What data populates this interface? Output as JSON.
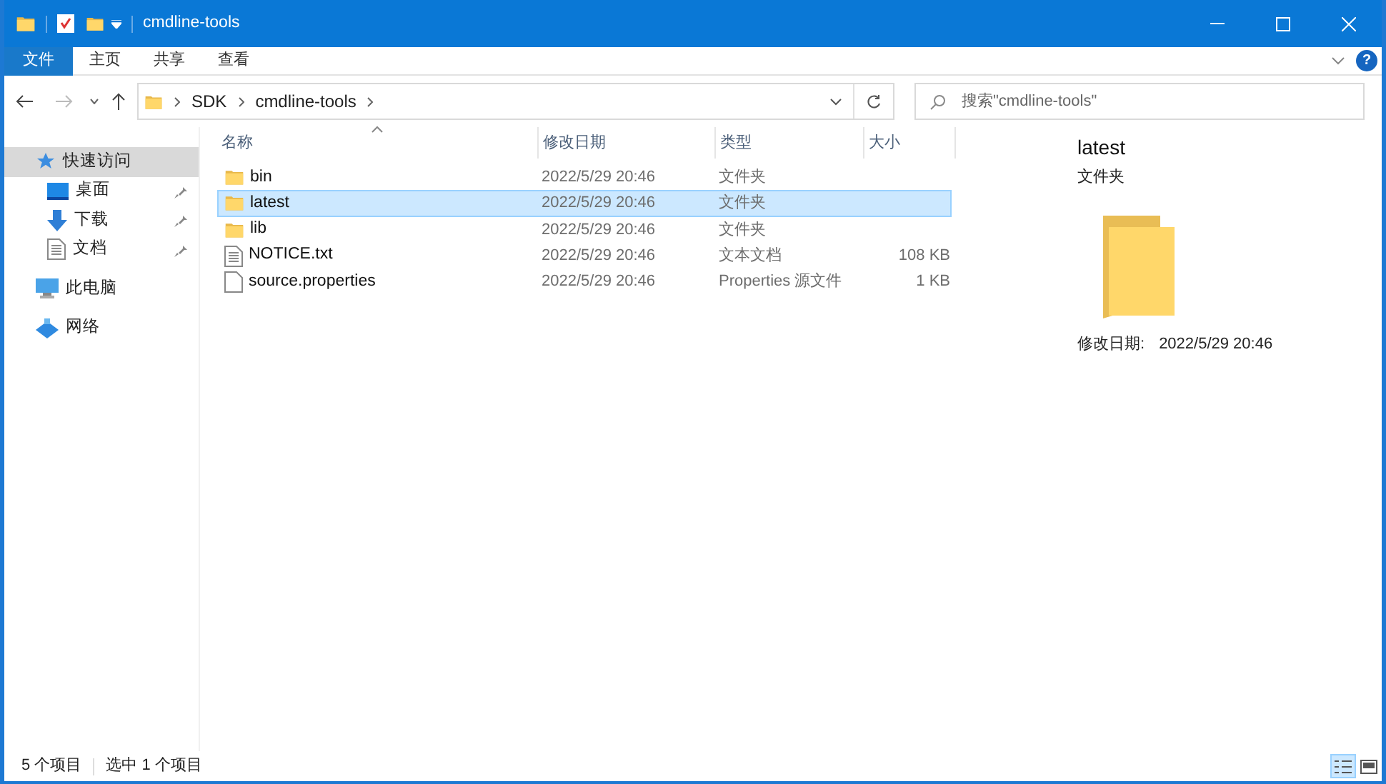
{
  "window": {
    "title": "cmdline-tools"
  },
  "ribbon": {
    "tabs": [
      {
        "label": "文件",
        "kind": "file"
      },
      {
        "label": "主页",
        "kind": "tab"
      },
      {
        "label": "共享",
        "kind": "tab"
      },
      {
        "label": "查看",
        "kind": "tab"
      }
    ]
  },
  "help": {
    "label": "?"
  },
  "address": {
    "path": [
      "SDK",
      "cmdline-tools"
    ]
  },
  "search": {
    "placeholder": "搜索\"cmdline-tools\""
  },
  "sidebar": {
    "items": [
      {
        "label": "快速访问",
        "kind": "star",
        "selected": true,
        "children": [
          {
            "label": "桌面",
            "kind": "desktop",
            "pinned": true,
            "selected": false
          },
          {
            "label": "下载",
            "kind": "download",
            "pinned": true,
            "selected": false
          },
          {
            "label": "文档",
            "kind": "document",
            "pinned": true,
            "selected": false
          }
        ]
      },
      {
        "label": "此电脑",
        "kind": "pc",
        "selected": false
      },
      {
        "label": "网络",
        "kind": "network",
        "selected": false
      }
    ]
  },
  "table": {
    "columns": [
      {
        "label": "名称",
        "sorted": true
      },
      {
        "label": "修改日期",
        "sorted": false
      },
      {
        "label": "类型",
        "sorted": false
      },
      {
        "label": "大小",
        "sorted": false
      }
    ],
    "rows": [
      {
        "name": "bin",
        "modified": "2022/5/29 20:46",
        "type": "文件夹",
        "kind": "folder",
        "selected": false
      },
      {
        "name": "latest",
        "modified": "2022/5/29 20:46",
        "type": "文件夹",
        "kind": "folder",
        "selected": true
      },
      {
        "name": "lib",
        "modified": "2022/5/29 20:46",
        "type": "文件夹",
        "kind": "folder",
        "selected": false
      },
      {
        "name": "NOTICE.txt",
        "modified": "2022/5/29 20:46",
        "type": "文本文档",
        "size": "108 KB",
        "kind": "text",
        "selected": false
      },
      {
        "name": "source.properties",
        "modified": "2022/5/29 20:46",
        "type": "Properties 源文件",
        "size": "1 KB",
        "kind": "file",
        "selected": false
      }
    ]
  },
  "preview": {
    "title": "latest",
    "subtitle": "文件夹",
    "modified_label": "修改日期:",
    "modified": "2022/5/29 20:46"
  },
  "status_bar": {
    "count": "5 个项目",
    "selection": "选中 1 个项目",
    "views": [
      {
        "kind": "details",
        "selected": true
      },
      {
        "kind": "tiles",
        "selected": false
      }
    ]
  }
}
